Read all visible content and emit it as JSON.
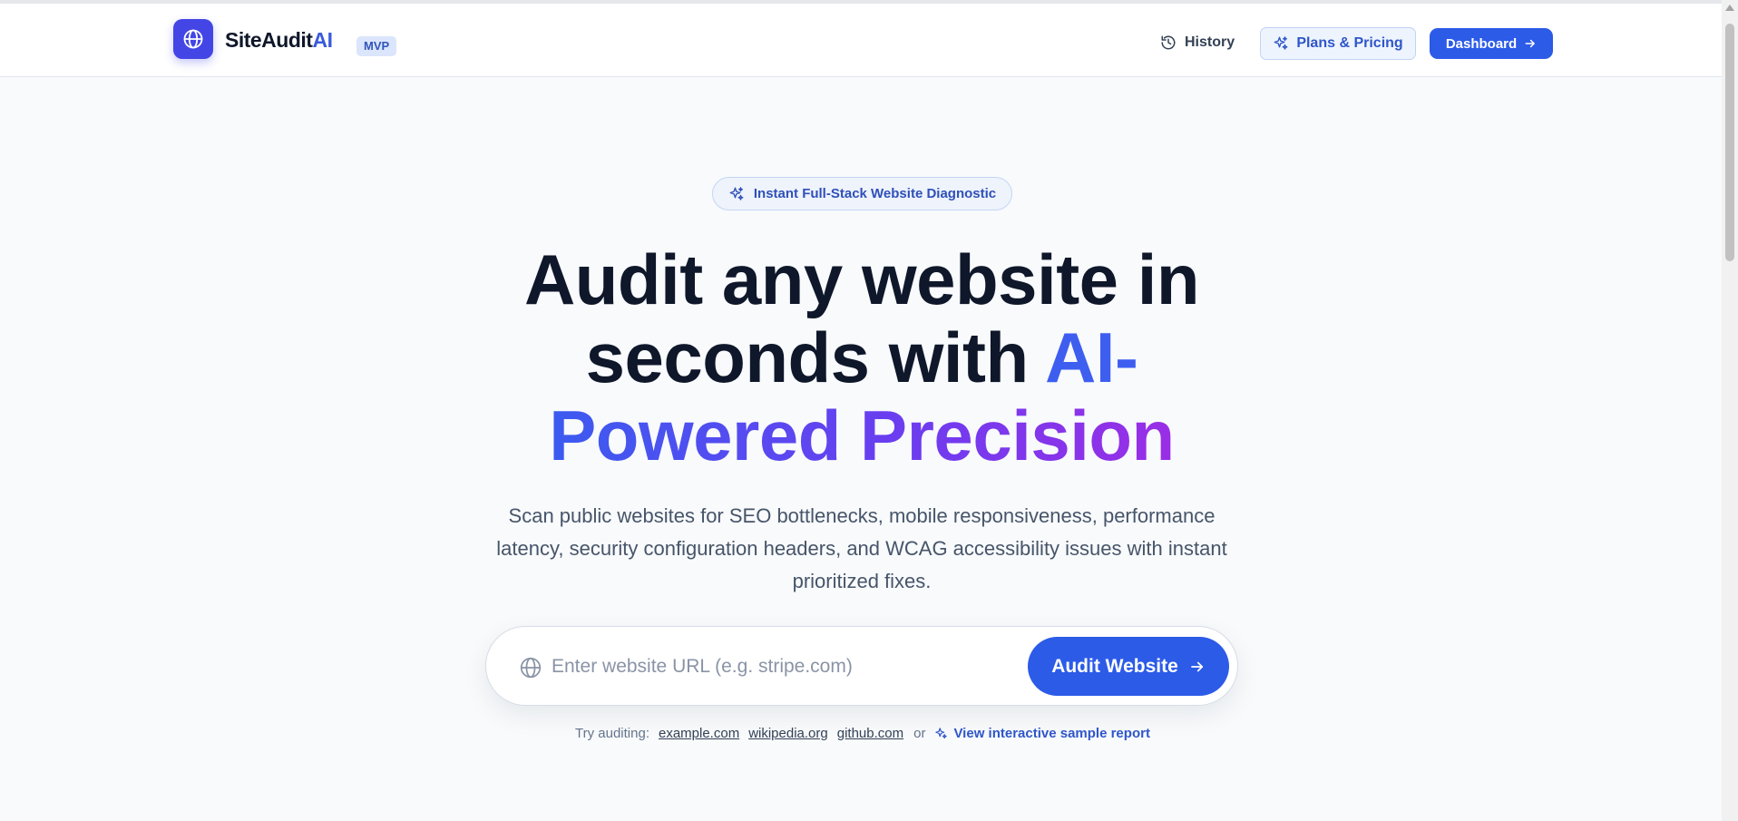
{
  "header": {
    "brand_main": "SiteAudit",
    "brand_accent": "AI",
    "badge": "MVP",
    "nav": {
      "history": "History",
      "pricing": "Plans & Pricing",
      "dashboard": "Dashboard"
    }
  },
  "hero": {
    "pill": "Instant Full-Stack Website Diagnostic",
    "headline_line1": "Audit any website in",
    "headline_line2_dark": "seconds with ",
    "headline_line2_accent": "AI-",
    "headline_line3": "Powered Precision",
    "subtitle": "Scan public websites for SEO bottlenecks, mobile responsiveness, performance latency, security configuration headers, and WCAG accessibility issues with instant prioritized fixes."
  },
  "search": {
    "value": "",
    "placeholder": "Enter website URL (e.g. stripe.com)",
    "button_label": "Audit Website"
  },
  "suggestions": {
    "label": "Try auditing:",
    "sites": [
      "example.com",
      "wikipedia.org",
      "github.com"
    ],
    "or": "or",
    "sample_link": "View interactive sample report"
  },
  "colors": {
    "primary": "#2c5be8",
    "logo_bg": "#4346e5",
    "gradient_start": "#3b5bf0",
    "gradient_end": "#9a2ee6",
    "page_bg": "#f8fafc"
  },
  "icons": {
    "logo": "globe-icon",
    "history": "history-clock-icon",
    "pricing": "sparkles-icon",
    "dashboard": "arrow-right-icon",
    "pill": "sparkles-icon",
    "search": "globe-icon",
    "audit": "arrow-right-icon",
    "sample": "sparkles-icon"
  }
}
